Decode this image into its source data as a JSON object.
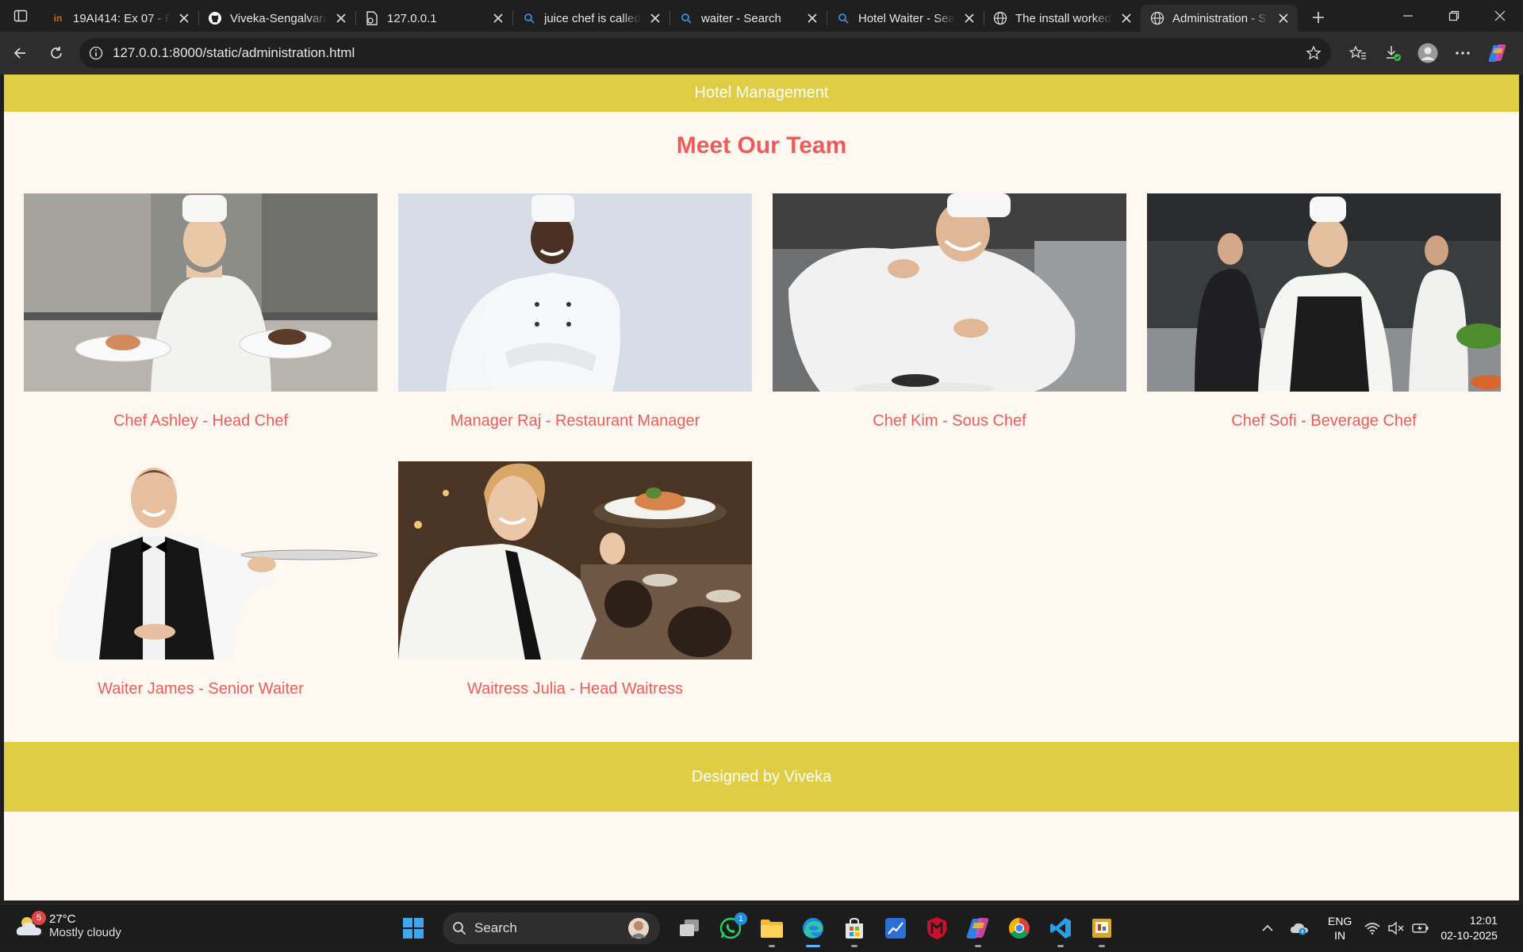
{
  "browser": {
    "tabs": [
      {
        "title": "19AI414: Ex 07 - R",
        "icon": "in-icon"
      },
      {
        "title": "Viveka-Sengalvaraya",
        "icon": "github-icon"
      },
      {
        "title": "127.0.0.1",
        "icon": "file-icon"
      },
      {
        "title": "juice chef is called",
        "icon": "search-icon"
      },
      {
        "title": "waiter - Search",
        "icon": "search-icon"
      },
      {
        "title": "Hotel Waiter - Search",
        "icon": "search-icon"
      },
      {
        "title": "The install worked",
        "icon": "globe-icon"
      },
      {
        "title": "Administration - S",
        "icon": "globe-icon",
        "active": true
      }
    ],
    "address": "127.0.0.1:8000/static/administration.html"
  },
  "page": {
    "header_title": "Hotel Management",
    "heading": "Meet Our Team",
    "team": [
      {
        "caption": "Chef Ashley - Head Chef",
        "photo": "chef-ashley-photo"
      },
      {
        "caption": "Manager Raj - Restaurant Manager",
        "photo": "manager-raj-photo"
      },
      {
        "caption": "Chef Kim - Sous Chef",
        "photo": "chef-kim-photo"
      },
      {
        "caption": "Chef Sofi - Beverage Chef",
        "photo": "chef-sofi-photo"
      },
      {
        "caption": "Waiter James - Senior Waiter",
        "photo": "waiter-james-photo"
      },
      {
        "caption": "Waitress Julia - Head Waitress",
        "photo": "waitress-julia-photo"
      }
    ],
    "footer_text": "Designed by Viveka"
  },
  "taskbar": {
    "weather_temp": "27°C",
    "weather_cond": "Mostly cloudy",
    "weather_badge": "5",
    "search_label": "Search",
    "whatsapp_badge": "1",
    "lang_top": "ENG",
    "lang_bottom": "IN",
    "time": "12:01",
    "date": "02-10-2025"
  },
  "colors": {
    "header": "#dfcd44",
    "heading": "#ee5b5b",
    "page_bg": "#fff8f1"
  }
}
